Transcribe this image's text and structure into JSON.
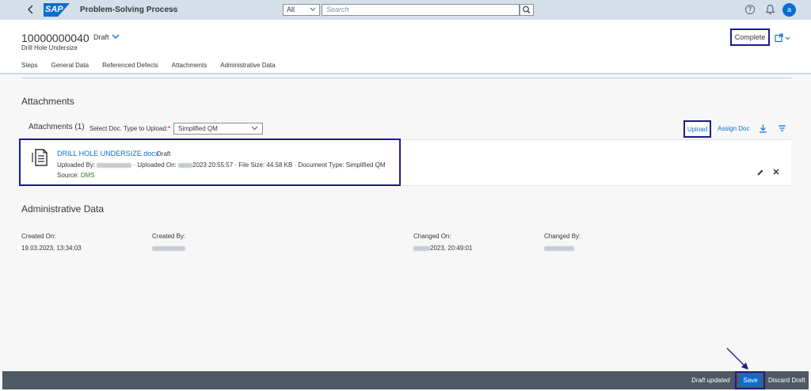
{
  "shell": {
    "logo_text": "SAP",
    "app_title": "Problem-Solving Process",
    "search_scope": "All",
    "search_placeholder": "Search",
    "avatar_initial": "a"
  },
  "header": {
    "object_id": "10000000040",
    "status": "Draft",
    "subtitle": "Drill Hole Undersize",
    "complete_label": "Complete",
    "tabs": [
      {
        "label": "Steps"
      },
      {
        "label": "General Data"
      },
      {
        "label": "Referenced Defects"
      },
      {
        "label": "Attachments"
      },
      {
        "label": "Administrative Data"
      }
    ]
  },
  "attachments": {
    "section_title": "Attachments",
    "toolbar_title": "Attachments (1)",
    "doc_type_label": "Select Doc. Type to Upload:",
    "doc_type_required": "*",
    "doc_type_value": "Simplified QM",
    "upload_label": "Upload",
    "assign_label": "Assign Doc",
    "item": {
      "file_name": "DRILL HOLE UNDERSIZE.docx",
      "status": "Draft",
      "uploaded_by_label": "Uploaded By:",
      "uploaded_on_label": "· Uploaded On:",
      "uploaded_on_value": "2023 20:55:57",
      "file_size": "· File Size: 44.58 KB",
      "doc_type": "· Document Type: Simplified QM",
      "source_label": "Source:",
      "source_value": "DMS"
    }
  },
  "admin": {
    "section_title": "Administrative Data",
    "created_on_label": "Created On:",
    "created_on_value": "19.03.2023, 13:34:03",
    "created_by_label": "Created By:",
    "changed_on_label": "Changed On:",
    "changed_on_value": "2023, 20:49:01",
    "changed_by_label": "Changed By:"
  },
  "footer": {
    "draft_status": "Draft updated",
    "save_label": "Save",
    "discard_label": "Discard Draft"
  },
  "colors": {
    "shell_bg": "#d5dfea",
    "brand_blue": "#0a6ed1",
    "highlight": "#1b1b8f",
    "footer_bg": "#4f5964"
  }
}
